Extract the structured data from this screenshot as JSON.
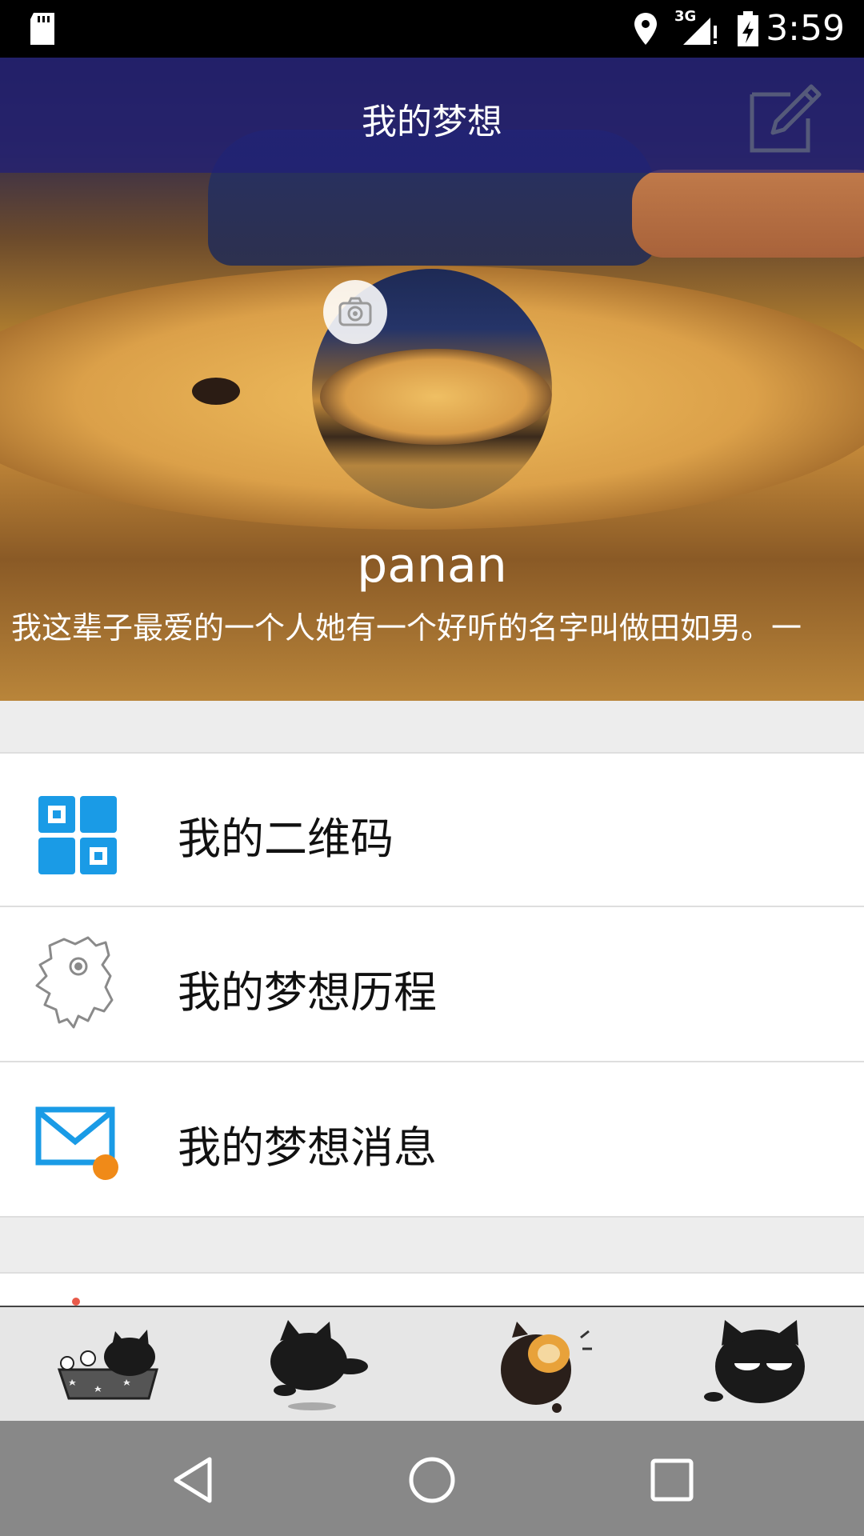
{
  "status_bar": {
    "network": "3G",
    "time": "3:59",
    "icons": [
      "sd-card-icon",
      "location-icon",
      "signal-icon",
      "battery-charging-icon"
    ]
  },
  "header": {
    "title": "我的梦想",
    "edit_icon": "edit-icon"
  },
  "profile": {
    "username": "panan",
    "bio": "我这辈子最爱的一个人她有一个好听的名字叫做田如男。一",
    "camera_icon": "camera-icon"
  },
  "menu": {
    "items": [
      {
        "label": "我的二维码",
        "icon": "qr-code-icon"
      },
      {
        "label": "我的梦想历程",
        "icon": "map-icon"
      },
      {
        "label": "我的梦想消息",
        "icon": "mail-icon"
      }
    ]
  },
  "tabbar": {
    "tabs": [
      {
        "icon": "cat-bath-icon"
      },
      {
        "icon": "cat-jump-icon"
      },
      {
        "icon": "cat-eat-icon"
      },
      {
        "icon": "cat-grumpy-icon"
      }
    ]
  },
  "navbar": {
    "buttons": [
      "back-icon",
      "home-icon",
      "recents-icon"
    ]
  },
  "colors": {
    "header_overlay": "#201e78",
    "qr_blue": "#1a9be6",
    "mail_orange": "#f08a18"
  }
}
